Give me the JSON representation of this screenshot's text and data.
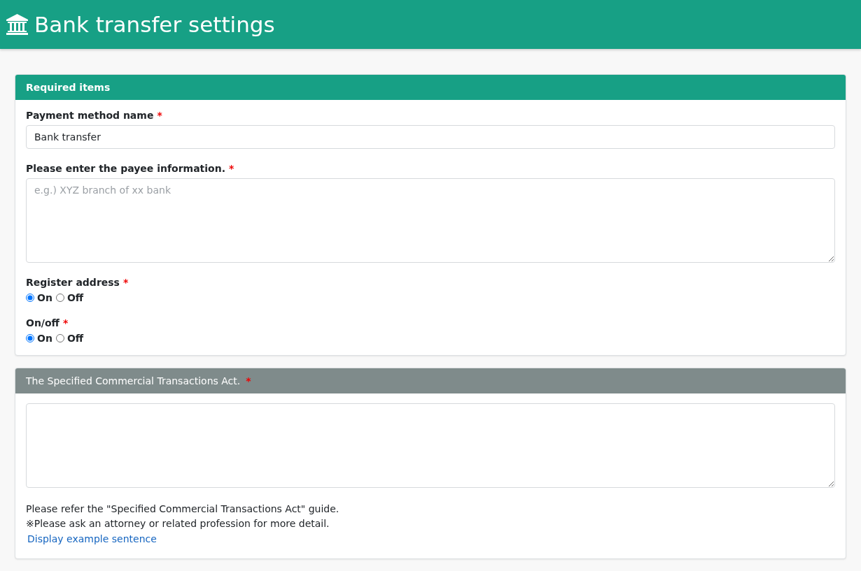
{
  "header": {
    "title": "Bank transfer settings"
  },
  "sections": [
    {
      "title": "Required items",
      "kind": "primary",
      "fields": [
        {
          "kind": "text",
          "label": "Payment method name",
          "required_mark": "*",
          "value": "Bank transfer"
        },
        {
          "kind": "textarea",
          "label": "Please enter the payee information.",
          "required_mark": "*",
          "placeholder": "e.g.) XYZ branch of xx bank"
        },
        {
          "kind": "radio",
          "label": "Register address",
          "required_mark": "*",
          "options": [
            {
              "label": "On",
              "selected": true
            },
            {
              "label": "Off",
              "selected": false
            }
          ]
        },
        {
          "kind": "radio",
          "label": "On/off",
          "required_mark": "*",
          "options": [
            {
              "label": "On",
              "selected": true
            },
            {
              "label": "Off",
              "selected": false
            }
          ]
        }
      ]
    },
    {
      "title": "The Specified Commercial Transactions Act.",
      "title_mark": "*",
      "kind": "secondary",
      "fields": [
        {
          "kind": "textarea"
        }
      ],
      "notes": [
        "Please refer the \"Specified Commercial Transactions Act\" guide.",
        "※Please ask an attorney or related profession for more detail."
      ],
      "link": "Display example sentence"
    }
  ]
}
